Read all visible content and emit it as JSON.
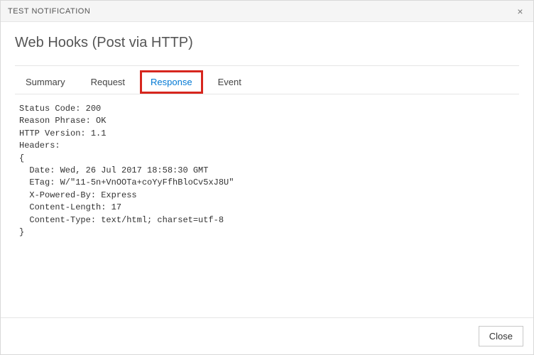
{
  "dialog": {
    "title": "TEST NOTIFICATION",
    "close_glyph": "×",
    "heading": "Web Hooks (Post via HTTP)"
  },
  "tabs": {
    "summary": "Summary",
    "request": "Request",
    "response": "Response",
    "event": "Event",
    "active": "response"
  },
  "response": {
    "status_code_label": "Status Code:",
    "status_code": "200",
    "reason_phrase_label": "Reason Phrase:",
    "reason_phrase": "OK",
    "http_version_label": "HTTP Version:",
    "http_version": "1.1",
    "headers_label": "Headers:",
    "headers": {
      "Date": "Wed, 26 Jul 2017 18:58:30 GMT",
      "ETag": "W/\"11-5n+VnOOTa+coYyFfhBloCv5xJ8U\"",
      "X-Powered-By": "Express",
      "Content-Length": "17",
      "Content-Type": "text/html; charset=utf-8"
    }
  },
  "footer": {
    "close_label": "Close"
  }
}
